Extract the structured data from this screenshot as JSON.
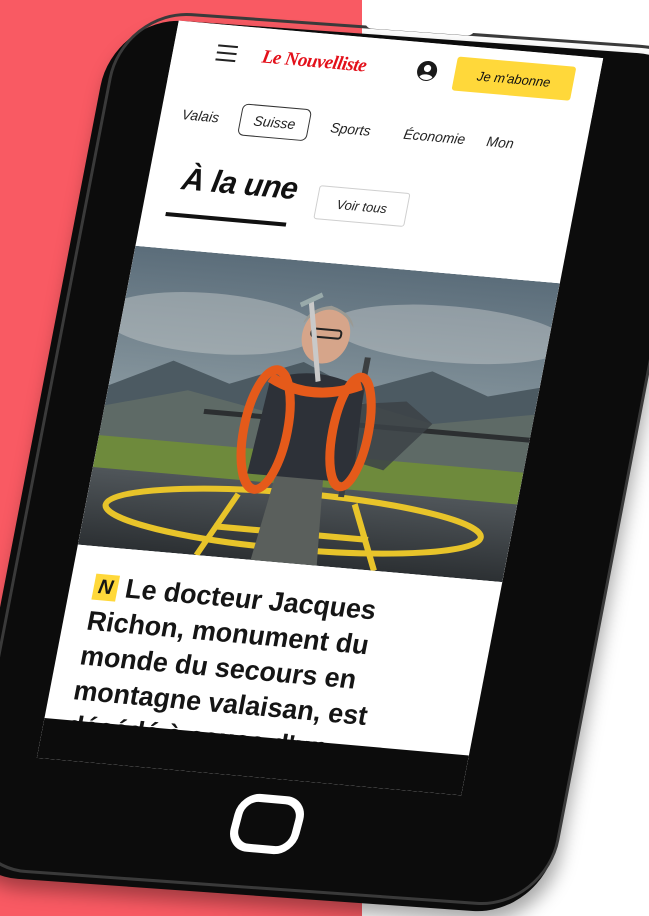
{
  "header": {
    "logo": "Le Nouvelliste",
    "subscribe_label": "Je m'abonne",
    "menu_icon": "hamburger-menu-icon",
    "account_icon": "user-account-icon"
  },
  "nav": {
    "tabs": [
      {
        "label": "Valais",
        "active": false
      },
      {
        "label": "Suisse",
        "active": true
      },
      {
        "label": "Sports",
        "active": false
      },
      {
        "label": "Économie",
        "active": false
      },
      {
        "label": "Mon",
        "active": false
      }
    ]
  },
  "section": {
    "title": "À la une",
    "see_all_label": "Voir tous"
  },
  "article": {
    "badge": "N",
    "headline": "Le docteur Jacques Richon, monument du monde du secours en montagne valaisan, est décédé à cause d'un"
  },
  "colors": {
    "background_left": "#f95a63",
    "logo_red": "#e3101a",
    "accent_yellow": "#ffd83a",
    "phone_black": "#0c0c0c"
  }
}
